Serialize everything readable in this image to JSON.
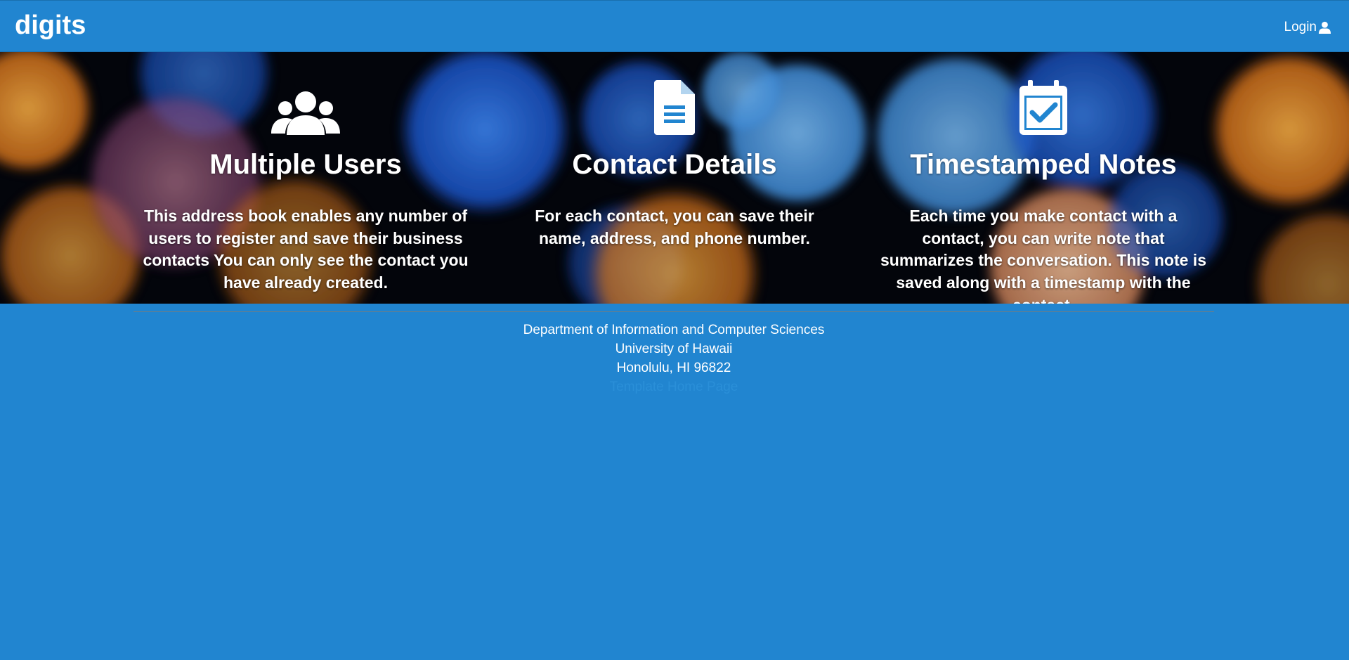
{
  "navbar": {
    "brand": "digits",
    "login_label": "Login",
    "login_icon": "user-icon"
  },
  "features": [
    {
      "icon": "users-icon",
      "title": "Multiple Users",
      "text": "This address book enables any number of users to register and save their business contacts You can only see the contact you have already created."
    },
    {
      "icon": "file-text-icon",
      "title": "Contact Details",
      "text": "For each contact, you can save their name, address, and phone number."
    },
    {
      "icon": "calendar-check-icon",
      "title": "Timestamped Notes",
      "text": "Each time you make contact with a contact, you can write note that summarizes the conversation. This note is saved along with a timestamp with the contact."
    }
  ],
  "footer": {
    "department": "Department of Information and Computer Sciences",
    "university": "University of Hawaii",
    "city": "Honolulu, HI 96822",
    "link_label": "Template Home Page"
  },
  "colors": {
    "primary": "#2185d0",
    "hero_dark": "#05070f",
    "link": "#2a8fd8"
  }
}
